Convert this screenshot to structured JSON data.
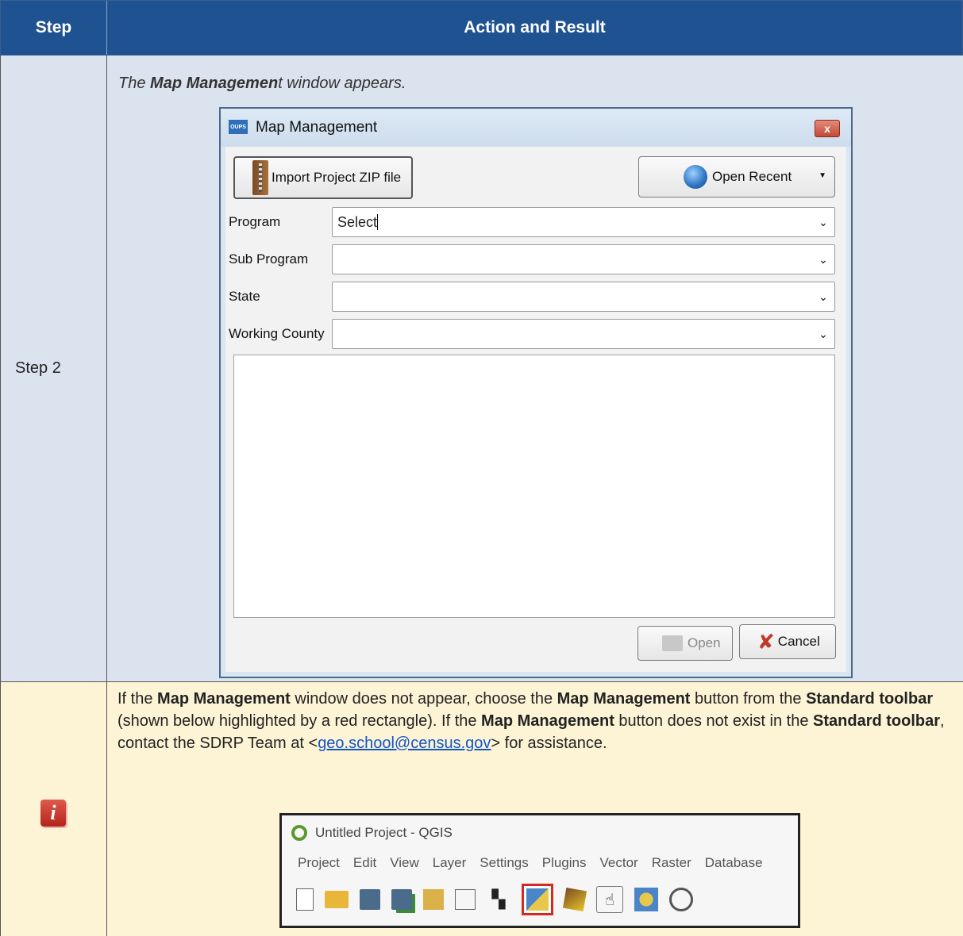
{
  "table": {
    "header_step": "Step",
    "header_action": "Action and Result"
  },
  "step2": {
    "step_label": "Step 2",
    "intro_prefix": "The ",
    "intro_bold": "Map Managemen",
    "intro_suffix": "t window appears."
  },
  "dialog": {
    "app_icon_text": "OUPS",
    "title": "Map Management",
    "close_symbol": "x",
    "import_button": "Import Project ZIP file",
    "open_recent_button": "Open Recent",
    "fields": [
      {
        "label": "Program",
        "value": "Select"
      },
      {
        "label": "Sub Program",
        "value": ""
      },
      {
        "label": "State",
        "value": ""
      },
      {
        "label": "Working County",
        "value": ""
      }
    ],
    "open_button": "Open",
    "cancel_button": "Cancel"
  },
  "note": {
    "t1": "If the ",
    "b1": "Map Management",
    "t2": " window does not appear, choose the ",
    "b2": "Map Management",
    "t3": " button from the ",
    "b3": "Standard toolbar",
    "t4": " (shown below highlighted by a red rectangle). If the ",
    "b4": "Map Management",
    "t5": " button does not exist in the ",
    "b5": "Standard toolbar",
    "t6": ", contact the SDRP Team at <",
    "email": "geo.school@census.gov",
    "t7": "> for assistance."
  },
  "qgis": {
    "title": "Untitled Project - QGIS",
    "menu": [
      "Project",
      "Edit",
      "View",
      "Layer",
      "Settings",
      "Plugins",
      "Vector",
      "Raster",
      "Database"
    ]
  }
}
